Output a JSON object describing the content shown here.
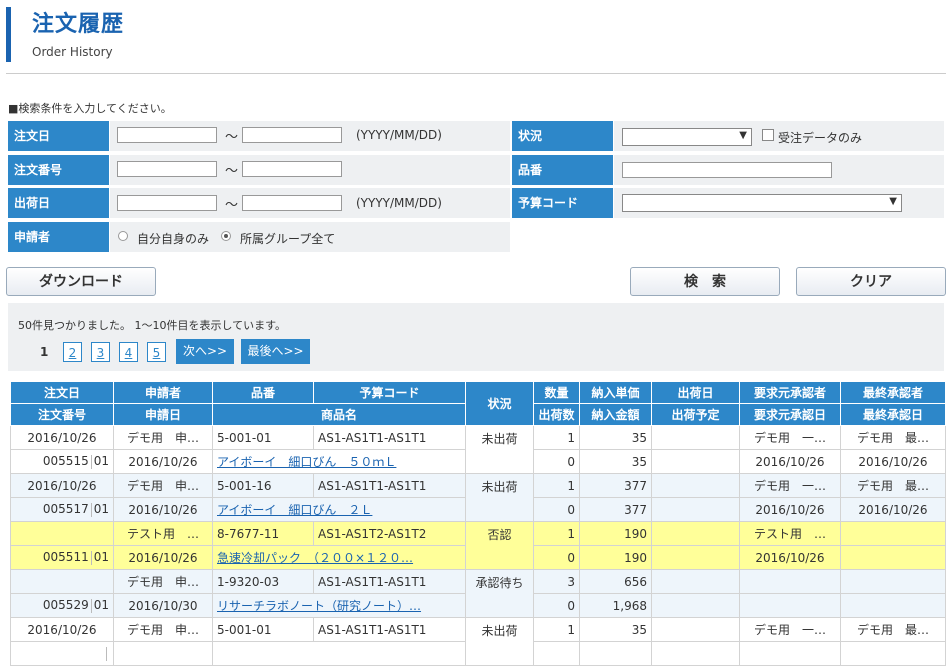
{
  "header": {
    "title": "注文履歴",
    "subtitle": "Order History"
  },
  "search": {
    "instruction": "■検索条件を入力してください。",
    "order_date_label": "注文日",
    "order_no_label": "注文番号",
    "ship_date_label": "出荷日",
    "applicant_label": "申請者",
    "status_label": "状況",
    "part_no_label": "品番",
    "budget_code_label": "予算コード",
    "tilde": "～",
    "date_hint": "(YYYY/MM/DD)",
    "received_only": "受注データのみ",
    "radio_self": "自分自身のみ",
    "radio_group": "所属グループ全て"
  },
  "buttons": {
    "download": "ダウンロード",
    "search": "検　索",
    "clear": "クリア"
  },
  "results": {
    "message": "50件見つかりました。 1～10件目を表示しています。",
    "current_page": "1",
    "pages": [
      "2",
      "3",
      "4",
      "5"
    ],
    "next": "次へ>>",
    "last": "最後へ>>"
  },
  "table": {
    "h1": [
      "注文日",
      "申請者",
      "品番",
      "予算コード",
      "状況",
      "数量",
      "納入単価",
      "出荷日",
      "要求元承認者",
      "最終承認者"
    ],
    "h2": [
      "注文番号",
      "申請日",
      "商品名",
      "出荷数",
      "納入金額",
      "出荷予定",
      "要求元承認日",
      "最終承認日"
    ],
    "orders": [
      {
        "style": "w",
        "order_date": "2016/10/26",
        "applicant": "デモ用　申…",
        "part_no": "5-001-01",
        "budget_code": "AS1-AS1T1-AS1T1",
        "status": "未出荷",
        "qty": "1",
        "unit_price": "35",
        "ship_date": "",
        "req_approver": "デモ用　一…",
        "final_approver": "デモ用　最…",
        "order_no": "005515",
        "order_sub": "01",
        "apply_date": "2016/10/26",
        "product": "アイボーイ　細口びん　５０ｍＬ",
        "ship_qty": "0",
        "amount": "35",
        "ship_plan": "",
        "req_approve_date": "2016/10/26",
        "final_approve_date": "2016/10/26"
      },
      {
        "style": "b",
        "order_date": "2016/10/26",
        "applicant": "デモ用　申…",
        "part_no": "5-001-16",
        "budget_code": "AS1-AS1T1-AS1T1",
        "status": "未出荷",
        "qty": "1",
        "unit_price": "377",
        "ship_date": "",
        "req_approver": "デモ用　一…",
        "final_approver": "デモ用　最…",
        "order_no": "005517",
        "order_sub": "01",
        "apply_date": "2016/10/26",
        "product": "アイボーイ　細口びん　２Ｌ",
        "ship_qty": "0",
        "amount": "377",
        "ship_plan": "",
        "req_approve_date": "2016/10/26",
        "final_approve_date": "2016/10/26"
      },
      {
        "style": "y",
        "order_date": "",
        "applicant": "テスト用　…",
        "part_no": "8-7677-11",
        "budget_code": "AS1-AS1T2-AS1T2",
        "status": "否認",
        "qty": "1",
        "unit_price": "190",
        "ship_date": "",
        "req_approver": "テスト用　…",
        "final_approver": "",
        "order_no": "005511",
        "order_sub": "01",
        "apply_date": "2016/10/26",
        "product": "急速冷却パック　（２００×１２０…",
        "ship_qty": "0",
        "amount": "190",
        "ship_plan": "",
        "req_approve_date": "2016/10/26",
        "final_approve_date": ""
      },
      {
        "style": "b",
        "order_date": "",
        "applicant": "デモ用　申…",
        "part_no": "1-9320-03",
        "budget_code": "AS1-AS1T1-AS1T1",
        "status": "承認待ち",
        "qty": "3",
        "unit_price": "656",
        "ship_date": "",
        "req_approver": "",
        "final_approver": "",
        "order_no": "005529",
        "order_sub": "01",
        "apply_date": "2016/10/30",
        "product": "リサーチラボノート（研究ノート）…",
        "ship_qty": "0",
        "amount": "1,968",
        "ship_plan": "",
        "req_approve_date": "",
        "final_approve_date": ""
      },
      {
        "style": "w",
        "order_date": "2016/10/26",
        "applicant": "デモ用　申…",
        "part_no": "5-001-01",
        "budget_code": "AS1-AS1T1-AS1T1",
        "status": "未出荷",
        "qty": "1",
        "unit_price": "35",
        "ship_date": "",
        "req_approver": "デモ用　一…",
        "final_approver": "デモ用　最…",
        "order_no": "",
        "order_sub": "",
        "apply_date": "",
        "product": "",
        "ship_qty": "",
        "amount": "",
        "ship_plan": "",
        "req_approve_date": "",
        "final_approve_date": ""
      }
    ]
  }
}
